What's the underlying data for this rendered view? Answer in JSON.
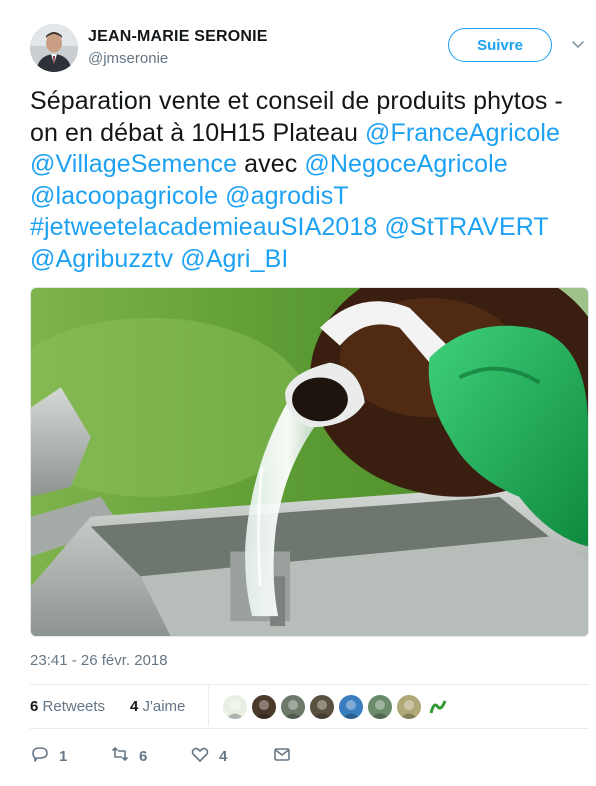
{
  "author": {
    "name": "JEAN-MARIE SERONIE",
    "handle": "@jmseronie",
    "follow_label": "Suivre"
  },
  "tweet": {
    "segments": [
      {
        "text": "Séparation vente et conseil de produits phytos - on en débat à 10H15 Plateau ",
        "link": false
      },
      {
        "text": "@FranceAgricole",
        "link": true
      },
      {
        "text": " ",
        "link": false
      },
      {
        "text": "@VillageSemence",
        "link": true
      },
      {
        "text": " avec ",
        "link": false
      },
      {
        "text": "@NegoceAgricole",
        "link": true
      },
      {
        "text": " ",
        "link": false
      },
      {
        "text": "@lacoopagricole",
        "link": true
      },
      {
        "text": " ",
        "link": false
      },
      {
        "text": "@agrodisT",
        "link": true
      },
      {
        "text": " ",
        "link": false
      },
      {
        "text": "#jetweetelacademieauSIA2018",
        "link": true
      },
      {
        "text": " ",
        "link": false
      },
      {
        "text": "@StTRAVERT",
        "link": true
      },
      {
        "text": " ",
        "link": false
      },
      {
        "text": "@Agribuzztv",
        "link": true
      },
      {
        "text": " ",
        "link": false
      },
      {
        "text": "@Agri_BI",
        "link": true
      }
    ],
    "timestamp": "23:41 - 26 févr. 2018"
  },
  "stats": {
    "retweets_count": "6",
    "retweets_label": "Retweets",
    "likes_count": "4",
    "likes_label": "J'aime",
    "liker_colors": [
      "#e8f0e4",
      "#4a3a2a",
      "#6d7a6a",
      "#5a5040",
      "#3b7ec0",
      "#6a8a6a",
      "#b0a878",
      "#ffffff"
    ]
  },
  "actions": {
    "reply_count": "1",
    "retweet_count": "6",
    "like_count": "4"
  },
  "colors": {
    "accent": "#1da1f2",
    "muted": "#657786",
    "text": "#14171a"
  }
}
